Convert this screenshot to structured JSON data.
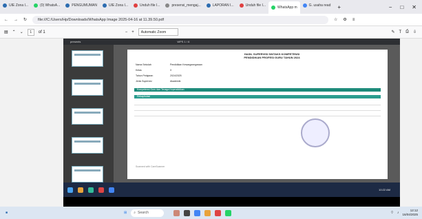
{
  "browser": {
    "tabs": [
      {
        "label": "UIE Zona I...",
        "color": "#2c6cb0"
      },
      {
        "label": "(0) WhatsA...",
        "color": "#25d366"
      },
      {
        "label": "PENGUMUMAN",
        "color": "#2c6cb0"
      },
      {
        "label": "UIE Zona I...",
        "color": "#2c6cb0"
      },
      {
        "label": "Unduh file I...",
        "color": "#e04040"
      },
      {
        "label": "presensi_mengaj...",
        "color": "#888"
      },
      {
        "label": "LAPORAN I...",
        "color": "#2c6cb0"
      },
      {
        "label": "Unduh file I...",
        "color": "#e04040"
      },
      {
        "label": "WhatsApp m",
        "color": "#25d366",
        "active": true
      },
      {
        "label": "G. usaha read",
        "color": "#4285f4"
      }
    ],
    "new_tab": "+",
    "url": "file:///C:/Users/Hp/Downloads/WhatsApp Image 2025-04-16 at 11.39.50.pdf"
  },
  "pdf_toolbar": {
    "page_value": "1",
    "page_total": "of 1",
    "zoom_minus": "−",
    "zoom_plus": "+",
    "zoom_value": "Automatic Zoom"
  },
  "screenshot_top": {
    "left": "presents",
    "mid": "WPS  1 / 6"
  },
  "document": {
    "title1": "HASIL SUPERVISI SINTAKS KOMPETENSI",
    "title2": "PENDIDIKAN PROFESI GURU TAHUN 2024",
    "rows": [
      {
        "k": "Nama Sekolah",
        "v": "Pendidikan Kewarganegaraan"
      },
      {
        "k": "Kelas",
        "v": "X"
      },
      {
        "k": "Tahun Pelajaran",
        "v": "2024/2025"
      },
      {
        "k": "Jenis Supervisi",
        "v": "Akademik"
      }
    ],
    "band1": "Kompetensi Guru dan Tenaga Kependidikan",
    "band2": "Rekapitulasi",
    "footer": "Scanned with CamScanner"
  },
  "inner_taskbar": {
    "clock": "10:22 AM"
  },
  "taskbar": {
    "search": "Search",
    "time": "12:12",
    "date": "16/04/2025"
  }
}
